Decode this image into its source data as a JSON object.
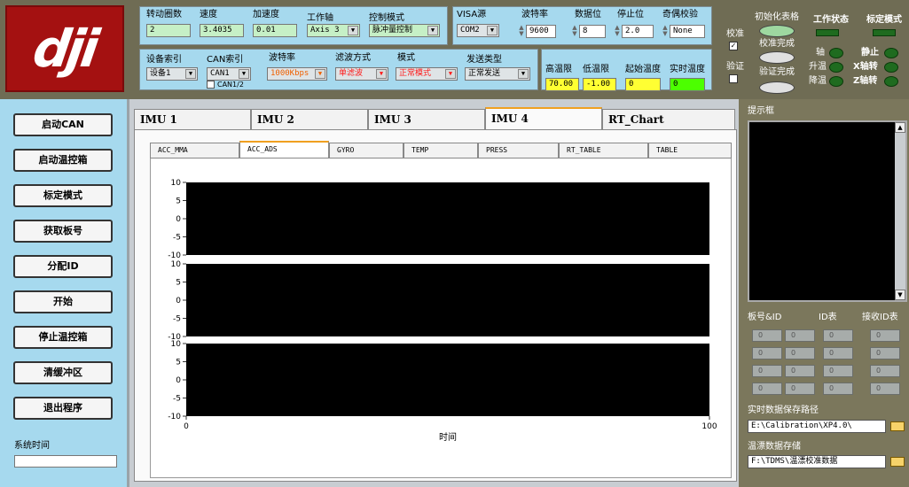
{
  "logo": {
    "text": "dji"
  },
  "motion": {
    "turns_label": "转动圈数",
    "turns": "2",
    "speed_label": "速度",
    "speed": "3.4035",
    "accel_label": "加速度",
    "accel": "0.01",
    "axis_label": "工作轴",
    "axis": "Axis 3",
    "mode_label": "控制模式",
    "mode": "脉冲量控制"
  },
  "device": {
    "index_label": "设备索引",
    "index": "设备1",
    "can_label": "CAN索引",
    "can": "CAN1",
    "can12_label": "CAN1/2",
    "baud_label": "波特率",
    "baud": "1000Kbps",
    "filter_label": "滤波方式",
    "filter": "单滤波",
    "mode_label": "模式",
    "mode": "正常模式",
    "send_label": "发送类型",
    "send": "正常发送"
  },
  "visa": {
    "src_label": "VISA源",
    "src": "COM2",
    "baud_label": "波特率",
    "baud": "9600",
    "databits_label": "数据位",
    "databits": "8",
    "stopbits_label": "停止位",
    "stopbits": "2.0",
    "parity_label": "奇偶校验",
    "parity": "None"
  },
  "temp": {
    "high_label": "高温限",
    "high": "70.00",
    "low_label": "低温限",
    "low": "-1.00",
    "start_label": "起始温度",
    "start": "0",
    "rt_label": "实时温度",
    "rt": "0"
  },
  "status": {
    "calib_label": "校准",
    "verify_label": "验证",
    "init_label": "初始化表格",
    "calib_done": "校准完成",
    "verify_done": "验证完成",
    "work_label": "工作状态",
    "cal_mode_label": "标定模式",
    "axis_led": "轴",
    "rise_led": "升温",
    "fall_led": "降温",
    "stop_led": "静止",
    "x_led": "X轴转",
    "z_led": "Z轴转"
  },
  "left": {
    "buttons": [
      "启动CAN",
      "启动温控箱",
      "标定模式",
      "获取板号",
      "分配ID",
      "开始",
      "停止温控箱",
      "清缓冲区",
      "退出程序"
    ],
    "time_label": "系统时间",
    "time_value": ""
  },
  "tabs": [
    "IMU 1",
    "IMU 2",
    "IMU 3",
    "IMU 4",
    "RT_Chart"
  ],
  "subtabs": [
    "ACC_MMA",
    "ACC_ADS",
    "GYRO",
    "TEMP",
    "PRESS",
    "RT_TABLE",
    "TABLE"
  ],
  "charts": {
    "xlabel": "时间",
    "xlim": [
      0,
      100
    ],
    "ylim": [
      -10,
      10
    ],
    "yticks": [
      "10",
      "5",
      "0",
      "-5",
      "-10"
    ],
    "xticks": [
      "0",
      "100"
    ]
  },
  "chart_data": {
    "type": "line",
    "xlabel": "时间",
    "ylabel": "",
    "xlim": [
      0,
      100
    ],
    "ylim": [
      -10,
      10
    ],
    "series": []
  },
  "right": {
    "prompt_label": "提示框",
    "board_label": "板号&ID",
    "id_label": "ID表",
    "recv_label": "接收ID表",
    "cell": "0",
    "rt_path_label": "实时数据保存路径",
    "rt_path": "E:\\Calibration\\XP4.0\\",
    "drift_label": "温漂数据存储",
    "drift_path": "F:\\TDMS\\温漂校准数据"
  }
}
